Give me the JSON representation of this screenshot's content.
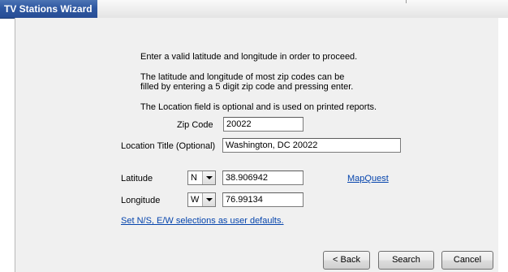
{
  "window": {
    "title": "TV Stations Wizard"
  },
  "instructions": {
    "line1": "Enter a valid latitude and longitude in order to proceed.",
    "line2": "The latitude and longitude of most zip codes can be",
    "line3": "filled by entering a 5 digit zip code and pressing enter.",
    "line4": "The Location field is optional and is used on printed reports."
  },
  "form": {
    "zip_label": "Zip Code",
    "zip_value": "20022",
    "location_label": "Location Title (Optional)",
    "location_value": "Washington, DC  20022",
    "latitude_label": "Latitude",
    "latitude_dir": "N",
    "latitude_value": "38.906942",
    "longitude_label": "Longitude",
    "longitude_dir": "W",
    "longitude_value": "76.99134",
    "mapquest_link": "MapQuest",
    "defaults_link": "Set N/S, E/W selections as user defaults."
  },
  "buttons": {
    "back": "< Back",
    "search": "Search",
    "cancel": "Cancel"
  }
}
